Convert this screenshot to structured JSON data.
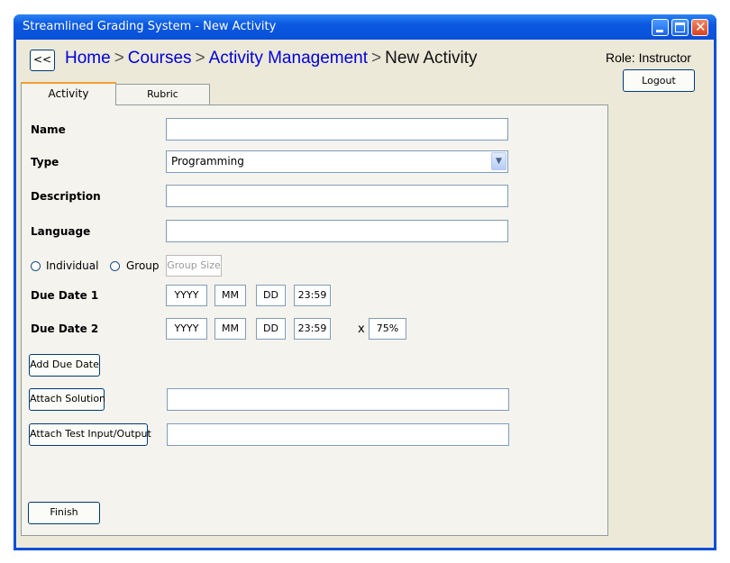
{
  "window": {
    "title": "Streamlined Grading System - New Activity"
  },
  "nav": {
    "back_label": "<<",
    "breadcrumb": [
      "Home",
      "Courses",
      "Activity Management",
      "New Activity"
    ],
    "separator": ">"
  },
  "header": {
    "role": "Role: Instructor",
    "logout_label": "Logout"
  },
  "tabs": [
    {
      "label": "Activity",
      "active": true
    },
    {
      "label": "Rubric",
      "active": false
    }
  ],
  "form": {
    "name_label": "Name",
    "name_value": "",
    "type_label": "Type",
    "type_value": "Programming",
    "description_label": "Description",
    "description_value": "",
    "language_label": "Language",
    "language_value": "",
    "individual_label": "Individual",
    "group_label": "Group",
    "group_size_placeholder": "Group Size",
    "due1": {
      "label": "Due Date 1",
      "year": "YYYY",
      "month": "MM",
      "day": "DD",
      "time": "23:59"
    },
    "due2": {
      "label": "Due Date 2",
      "year": "YYYY",
      "month": "MM",
      "day": "DD",
      "time": "23:59",
      "multiplier_symbol": "x",
      "percent": "75%"
    },
    "add_due_date_label": "Add Due Date",
    "attach_solution_label": "Attach Solution",
    "attach_solution_value": "",
    "attach_test_label": "Attach Test Input/Output",
    "attach_test_value": "",
    "finish_label": "Finish"
  },
  "colors": {
    "titlebar": "#0b58e0",
    "link": "#0000d9",
    "client_bg": "#ece9d8",
    "tab_accent": "#f0a030"
  }
}
